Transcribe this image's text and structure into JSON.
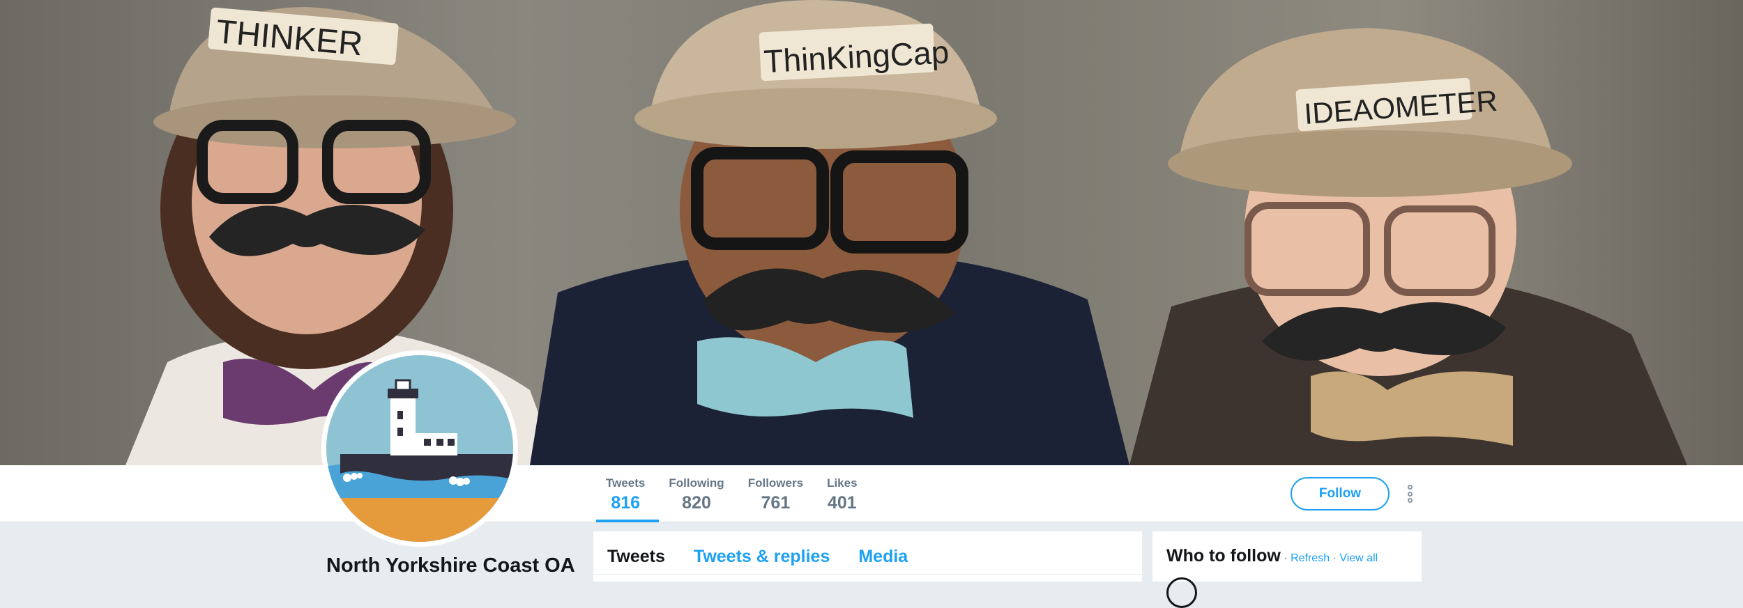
{
  "profile": {
    "name": "North Yorkshire Coast OA"
  },
  "banner": {
    "cap_labels": [
      "THINKER",
      "ThinKingCap",
      "IDEAOMETER"
    ]
  },
  "stats": [
    {
      "label": "Tweets",
      "value": "816",
      "active": true
    },
    {
      "label": "Following",
      "value": "820",
      "active": false
    },
    {
      "label": "Followers",
      "value": "761",
      "active": false
    },
    {
      "label": "Likes",
      "value": "401",
      "active": false
    }
  ],
  "actions": {
    "follow_label": "Follow",
    "more_icon": "more-vertical-icon"
  },
  "timeline": {
    "tabs": [
      {
        "label": "Tweets",
        "active": true
      },
      {
        "label": "Tweets & replies",
        "active": false
      },
      {
        "label": "Media",
        "active": false
      }
    ]
  },
  "who_to_follow": {
    "title": "Who to follow",
    "separator": "·",
    "refresh_label": "Refresh",
    "view_all_label": "View all"
  },
  "colors": {
    "accent": "#1da1f2",
    "page_bg": "#e6ecf0",
    "muted_text": "#657786"
  }
}
